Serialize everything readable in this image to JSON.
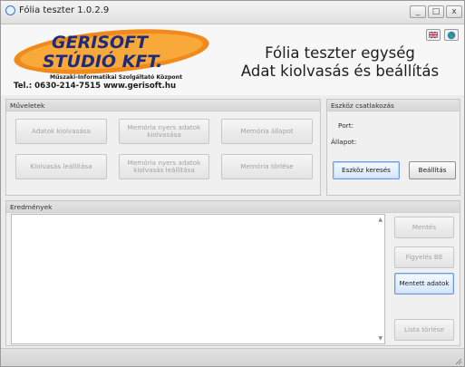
{
  "window": {
    "title": "Fólia teszter 1.0.2.9",
    "controls": {
      "minimize": "_",
      "maximize": "□",
      "close": "x"
    }
  },
  "header": {
    "logo": {
      "line1": "GERISOFT",
      "line2": "STÚDIÓ KFT.",
      "slogan": "Műszaki-Informatikai Szolgáltató Központ",
      "contact": "Tel.: 0630-214-7515   www.gerisoft.hu"
    },
    "title_line1": "Fólia teszter egység",
    "title_line2": "Adat kiolvasás és beállítás",
    "icons": [
      "flag-icon",
      "globe-icon"
    ]
  },
  "operations": {
    "title": "Műveletek",
    "buttons": {
      "read_data": "Adatok kiolvasása",
      "read_raw_memory": "Memória nyers adatok kiolvasása",
      "memory_state": "Memória állapot",
      "stop_reading": "Kiolvasás leállítása",
      "stop_raw_memory": "Memória nyers adatok kiolvasás leállítása",
      "clear_memory": "Memória törlése"
    }
  },
  "device": {
    "title": "Eszköz csatlakozás",
    "port_label": "Port:",
    "state_label": "Állapot:",
    "search_button": "Eszköz keresés",
    "settings_button": "Beállítás"
  },
  "results": {
    "title": "Eredmények",
    "buttons": {
      "save": "Mentés",
      "watch_on": "Figyelés BE",
      "saved_data": "Mentett adatok",
      "clear_list": "Lista törlése"
    }
  },
  "colors": {
    "logo_orange": "#f08a1c",
    "logo_blue": "#1c2c7a",
    "highlight": "#6d9bd8"
  }
}
